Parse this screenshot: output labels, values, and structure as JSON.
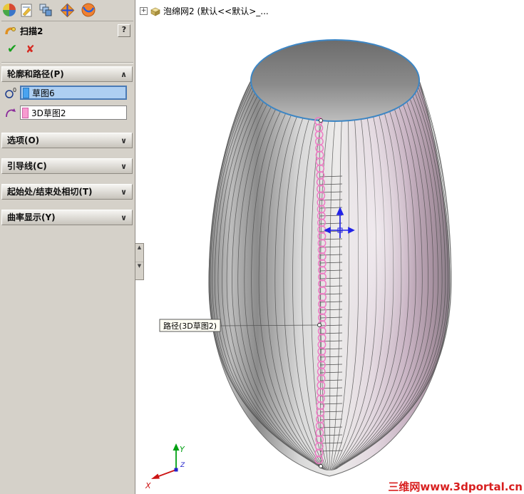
{
  "colors": {
    "panel_bg": "#d5d1c9",
    "selection_fill": "#aecff2",
    "profile_swatch": "#49a3f0",
    "path_swatch": "#f79cd0",
    "helix_pink": "#ef79c4",
    "opening_stroke": "#3d86c4",
    "ok_green": "#17a01e",
    "cancel_red": "#d62b22",
    "watermark_red": "#d81f1f",
    "move_arrow_blue": "#2222e8"
  },
  "panel": {
    "title": "扫描2",
    "help_label": "?",
    "ok_glyph": "✔",
    "cancel_glyph": "✘",
    "groups": [
      {
        "label": "轮廓和路径(P)",
        "chevron": "∧",
        "state": "expanded"
      },
      {
        "label": "选项(O)",
        "chevron": "∨",
        "state": "collapsed"
      },
      {
        "label": "引导线(C)",
        "chevron": "∨",
        "state": "collapsed"
      },
      {
        "label": "起始处/结束处相切(T)",
        "chevron": "∨",
        "state": "collapsed"
      },
      {
        "label": "曲率显示(Y)",
        "chevron": "∨",
        "state": "collapsed"
      }
    ],
    "profile_field": {
      "value": "草图6",
      "icon_sup": "0"
    },
    "path_field": {
      "value": "3D草图2"
    }
  },
  "feature_tree": {
    "expand_glyph": "+",
    "item_label": "泡绵网2 (默认<<默认>_..."
  },
  "viewport": {
    "callout_label": "路径(3D草图2)",
    "watermark": "三维网www.3dportal.cn",
    "triad": {
      "x_label": "X",
      "y_label": "Y",
      "z_label": "Z"
    }
  }
}
